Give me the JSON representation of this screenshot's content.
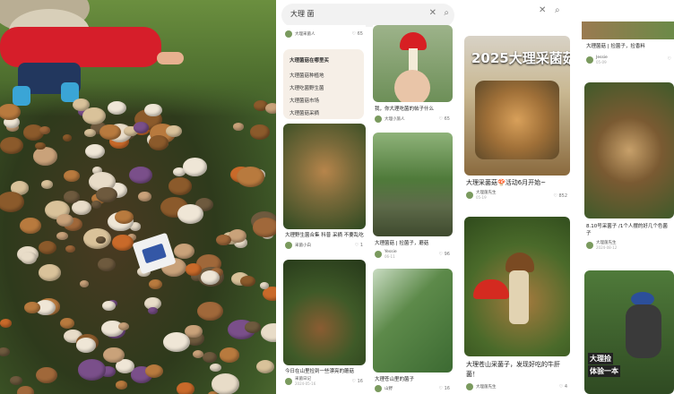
{
  "search": {
    "query": "大理 菌",
    "search_icon": "search-icon",
    "clear_icon": "close-icon"
  },
  "sug": {
    "header": "大理菌菇在哪里买",
    "items": [
      "大理菌菇种植地",
      "大理吃菌野生菌",
      "大理菌菇市场",
      "大理菌菇采摘"
    ]
  },
  "p2": {
    "c0": {
      "author": "大理采菌人",
      "likes": "65"
    },
    "c1": {
      "title": "大理野生菌合集 科普 采摘 不要乱吃",
      "author": "采菌小白",
      "likes": "1"
    },
    "c2": {
      "title": "今日在山里捡到一些漂亮的蘑菇",
      "author": "采菌日记",
      "date": "2024-05-16",
      "likes": "16"
    },
    "c3": {
      "title": "我，你大理吃菌的帖子什么",
      "author": "大理小旅人",
      "likes": "65"
    },
    "c4": {
      "title": "大理菌菇 | 捡菌子，蘑菇",
      "author": "Yessie",
      "date": "06-11",
      "likes": "96"
    },
    "c5": {
      "title": "大理苍山里的菌子",
      "author": "山野",
      "likes": "16"
    }
  },
  "p3": {
    "c0": {
      "title": "2025大理采菌菇",
      "cap": "大理采菌菇🍄活动6月开始~",
      "author": "大理菌先生",
      "date": "05-19",
      "likes": "852"
    },
    "c1": {
      "cap": "大理苍山采菌子，发现好吃的牛肝菌！",
      "author": "大理菌先生",
      "likes": "4"
    }
  },
  "p4": {
    "c0": {
      "title": "大理菌菇 | 捡菌子，捡香料",
      "author": "Jessie",
      "date": "05-09"
    },
    "c1": {
      "title": "8.10号采菌子 /1个人摆的好几个色菌子",
      "author": "大理菌先生",
      "date": "2024-08-12"
    },
    "c2": {
      "overlay1": "大理捡",
      "overlay2": "体验一本"
    }
  },
  "colors": {
    "like": "#ff2442",
    "accent": "#ff2442"
  }
}
